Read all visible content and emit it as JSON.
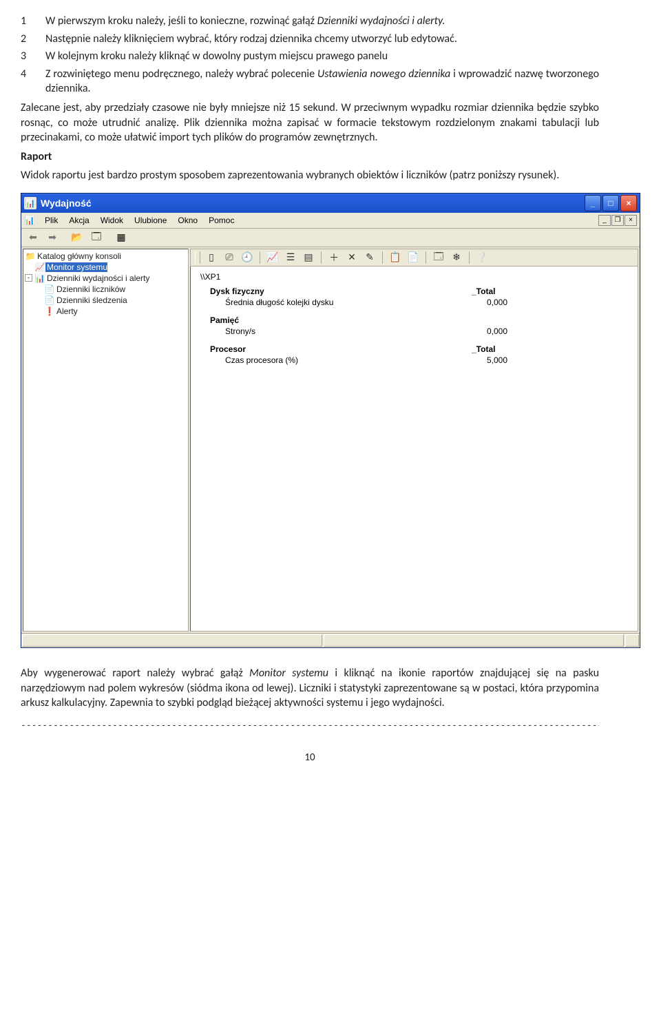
{
  "steps": [
    {
      "num": "1",
      "text_a": "W pierwszym kroku należy, jeśli to konieczne, rozwinąć gałąź ",
      "italic": "Dzienniki wydajności i alerty.",
      "text_b": ""
    },
    {
      "num": "2",
      "text_a": "Następnie należy kliknięciem wybrać, który rodzaj dziennika chcemy utworzyć lub edytować.",
      "italic": "",
      "text_b": ""
    },
    {
      "num": "3",
      "text_a": "W kolejnym kroku należy kliknąć w dowolny pustym miejscu prawego panelu",
      "italic": "",
      "text_b": ""
    },
    {
      "num": "4",
      "text_a": "Z rozwiniętego menu podręcznego, należy wybrać polecenie ",
      "italic": "Ustawienia nowego dziennika",
      "text_b": " i wprowadzić nazwę tworzonego dziennika."
    }
  ],
  "para1": "Zalecane jest, aby przedziały czasowe nie były mniejsze niż 15 sekund. W przeciwnym wypadku rozmiar dziennika będzie szybko rosnąc, co może utrudnić analizę. Plik dziennika można zapisać w formacie tekstowym rozdzielonym znakami tabulacji lub przecinakami, co może ułatwić import tych plików do programów zewnętrznych.",
  "raport_heading": "Raport",
  "para2": "Widok raportu jest bardzo prostym sposobem zaprezentowania wybranych obiektów i liczników (patrz poniższy rysunek).",
  "window": {
    "title": "Wydajność",
    "menu": [
      "Plik",
      "Akcja",
      "Widok",
      "Ulubione",
      "Okno",
      "Pomoc"
    ],
    "tree": {
      "root": "Katalog główny konsoli",
      "monitor": "Monitor systemu",
      "logs": "Dzienniki wydajności i alerty",
      "children": [
        "Dzienniki liczników",
        "Dzienniki śledzenia",
        "Alerty"
      ]
    },
    "report": {
      "host": "\\\\XP1",
      "groups": [
        {
          "title": "Dysk fizyczny",
          "instance": "_Total",
          "metric": "Średnia długość kolejki dysku",
          "value": "0,000"
        },
        {
          "title": "Pamięć",
          "instance": "",
          "metric": "Strony/s",
          "value": "0,000"
        },
        {
          "title": "Procesor",
          "instance": "_Total",
          "metric": "Czas procesora (%)",
          "value": "5,000"
        }
      ]
    }
  },
  "para3_a": "Aby wygenerować raport należy wybrać gałąż ",
  "para3_italic": "Monitor systemu",
  "para3_b": " i kliknąć na ikonie raportów znajdującej się na pasku narzędziowym nad polem wykresów (siódma ikona od lewej). Liczniki i statystyki zaprezentowane są w postaci, która przypomina arkusz kalkulacyjny. Zapewnia to szybki podgląd bieżącej aktywności systemu i jego wydajności.",
  "dashes": "-------------------------------------------------------------------------------------------------------------------------",
  "page": "10"
}
